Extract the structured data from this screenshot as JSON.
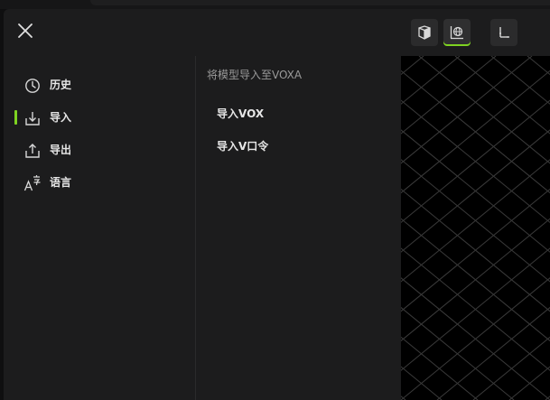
{
  "menu": {
    "close_label": "close",
    "items": [
      {
        "label": "历史",
        "icon": "history-icon",
        "active": false
      },
      {
        "label": "导入",
        "icon": "import-icon",
        "active": true
      },
      {
        "label": "导出",
        "icon": "export-icon",
        "active": false
      },
      {
        "label": "语言",
        "icon": "language-icon",
        "active": false
      }
    ]
  },
  "import_section": {
    "title": "将模型导入至VOXA",
    "actions": [
      {
        "label": "导入VOX"
      },
      {
        "label": "导入V口令"
      }
    ]
  },
  "toolbar": {
    "buttons": [
      {
        "icon": "cube-icon",
        "active": false
      },
      {
        "icon": "globe-grid-icon",
        "active": true
      },
      {
        "icon": "axes-icon",
        "active": false
      }
    ]
  },
  "colors": {
    "accent": "#7ed321",
    "panel_bg": "#1c1c1d",
    "text": "#e6e6e6",
    "muted_text": "#9a9a9a",
    "viewport_bg": "#000000"
  }
}
